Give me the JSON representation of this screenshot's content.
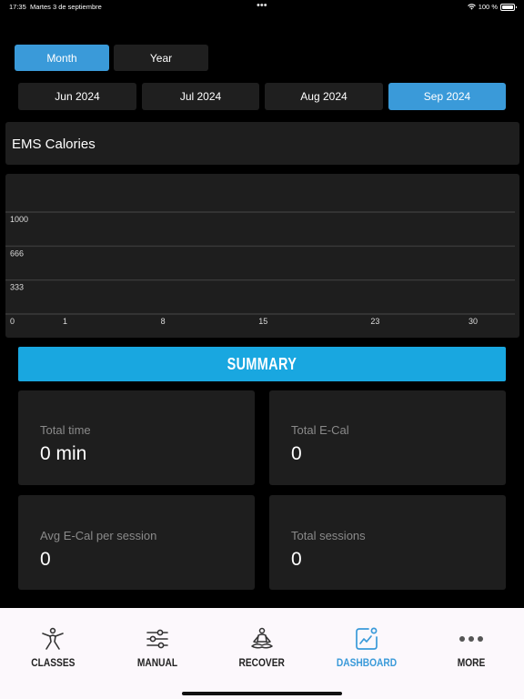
{
  "status_bar": {
    "time": "17:35",
    "date": "Martes 3 de septiembre",
    "battery": "100 %"
  },
  "period_toggle": [
    {
      "label": "Month",
      "active": true
    },
    {
      "label": "Year",
      "active": false
    }
  ],
  "months": [
    {
      "label": "Jun 2024",
      "active": false
    },
    {
      "label": "Jul 2024",
      "active": false
    },
    {
      "label": "Aug 2024",
      "active": false
    },
    {
      "label": "Sep 2024",
      "active": true
    }
  ],
  "chart_title": "EMS Calories",
  "chart_data": {
    "type": "bar",
    "x_ticks": [
      "1",
      "8",
      "15",
      "23",
      "30"
    ],
    "y_ticks": [
      "0",
      "333",
      "666",
      "1000"
    ],
    "x": [],
    "values": [],
    "ylim": [
      0,
      1000
    ],
    "grid": true
  },
  "summary_label": "SUMMARY",
  "stats": [
    {
      "label": "Total time",
      "value": "0 min"
    },
    {
      "label": "Total E-Cal",
      "value": "0"
    },
    {
      "label": "Avg E-Cal per session",
      "value": "0"
    },
    {
      "label": "Total sessions",
      "value": "0"
    }
  ],
  "tabs": [
    {
      "label": "CLASSES",
      "icon": "person-stretch-icon",
      "active": false
    },
    {
      "label": "MANUAL",
      "icon": "sliders-icon",
      "active": false
    },
    {
      "label": "RECOVER",
      "icon": "meditation-icon",
      "active": false
    },
    {
      "label": "DASHBOARD",
      "icon": "chart-badge-icon",
      "active": true
    },
    {
      "label": "MORE",
      "icon": "ellipsis-icon",
      "active": false
    }
  ],
  "colors": {
    "accent": "#3a9ad9",
    "summary": "#19a7e0",
    "card": "#1e1e1e",
    "background": "#000000"
  }
}
